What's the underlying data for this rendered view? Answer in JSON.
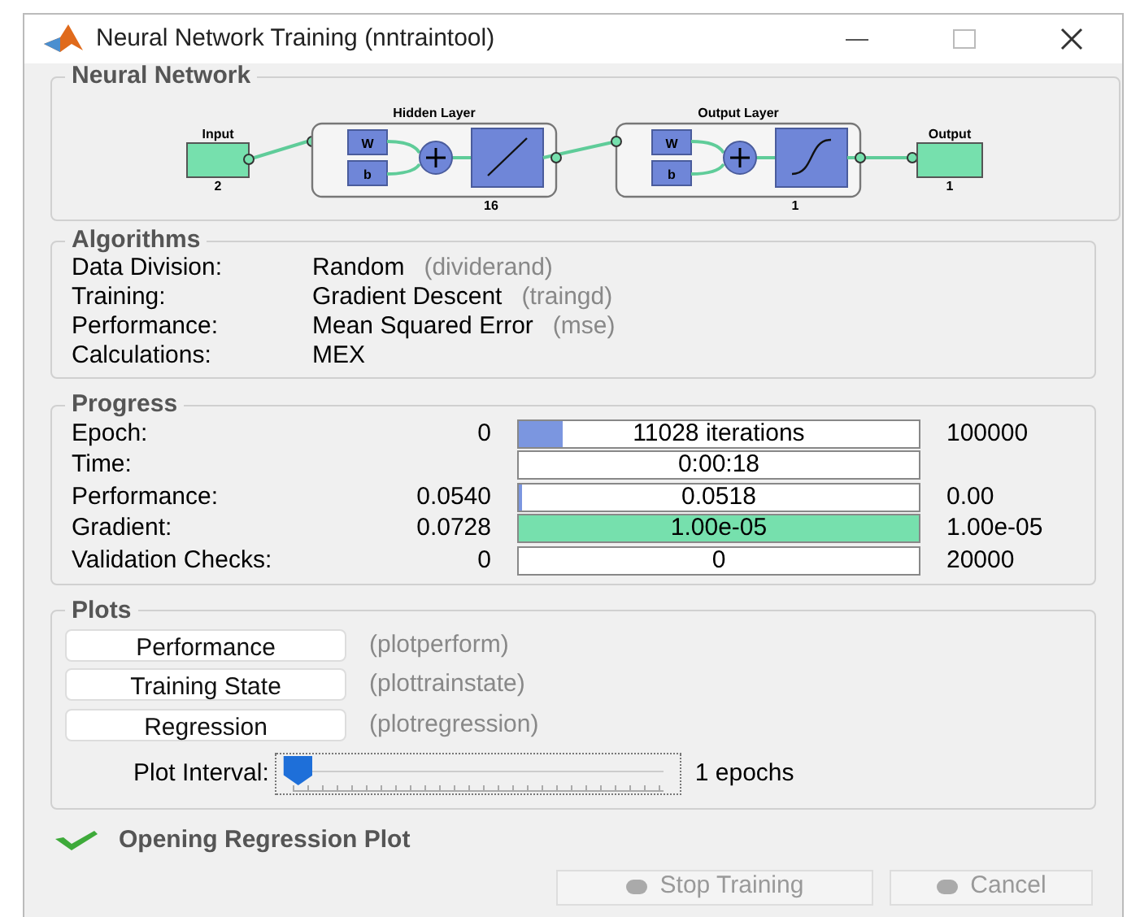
{
  "window": {
    "title": "Neural Network Training (nntraintool)"
  },
  "network": {
    "title": "Neural Network",
    "input": {
      "label": "Input",
      "size": "2"
    },
    "layers": [
      {
        "title": "Hidden Layer",
        "weight": "W",
        "bias": "b",
        "size": "16",
        "kind": "linear"
      },
      {
        "title": "Output Layer",
        "weight": "W",
        "bias": "b",
        "size": "1",
        "kind": "sigmoid"
      }
    ],
    "output": {
      "label": "Output",
      "size": "1"
    }
  },
  "algorithms": {
    "title": "Algorithms",
    "rows": [
      {
        "label": "Data Division:",
        "value": "Random",
        "code": "(dividerand)"
      },
      {
        "label": "Training:",
        "value": "Gradient Descent",
        "code": "(traingd)"
      },
      {
        "label": "Performance:",
        "value": "Mean Squared Error",
        "code": "(mse)"
      },
      {
        "label": "Calculations:",
        "value": "MEX"
      }
    ]
  },
  "progress": {
    "title": "Progress",
    "rows": [
      {
        "label": "Epoch:",
        "start": "0",
        "bar": "11028 iterations",
        "level": 0.11,
        "color": "#7b96e0",
        "end": "100000"
      },
      {
        "label": "Time:",
        "bar": "0:00:18"
      },
      {
        "label": "Performance:",
        "start": "0.0540",
        "bar": "0.0518",
        "level": 0.01,
        "color": "#7b96e0",
        "end": "0.00"
      },
      {
        "label": "Gradient:",
        "start": "0.0728",
        "bar": "1.00e-05",
        "level": 1,
        "color": "#76e0ad",
        "end": "1.00e-05"
      },
      {
        "label": "Validation Checks:",
        "start": "0",
        "bar": "0",
        "end": "20000"
      }
    ]
  },
  "plots": {
    "title": "Plots",
    "items": [
      {
        "button": "Performance",
        "function": "(plotperform)"
      },
      {
        "button": "Training State",
        "function": "(plottrainstate)"
      },
      {
        "button": "Regression",
        "function": "(plotregression)"
      }
    ],
    "interval": {
      "label": "Plot Interval:",
      "level": 0,
      "reading": "1 epochs"
    }
  },
  "status": {
    "text": "Opening Regression Plot"
  },
  "buttons": [
    {
      "label": "Stop Training",
      "disabled": true
    },
    {
      "label": "Cancel",
      "disabled": true
    }
  ]
}
